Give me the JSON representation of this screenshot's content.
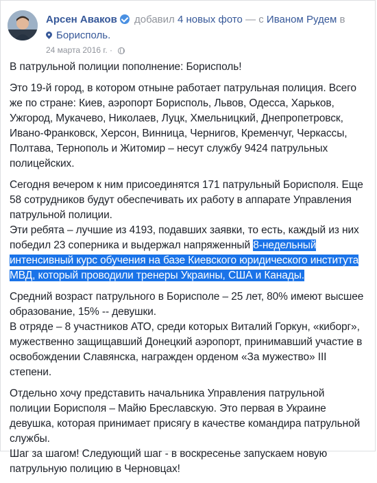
{
  "post": {
    "author": "Арсен Аваков",
    "action_prefix": "добавил",
    "action_link": "4 новых фото",
    "with_label": "— с",
    "with_person": "Иваном Рудем",
    "in_label": "в",
    "location": "Борисполь.",
    "timestamp": "24 марта 2016 г.",
    "audience_separator": "·",
    "colors": {
      "link": "#365899",
      "muted": "#90949c",
      "selection": "#1a73e8"
    }
  },
  "content": {
    "p1": [
      "В патрульной полиции пополнение: Борисполь!"
    ],
    "p2": [
      "Это 19-й город, в котором отныне работает патрульная полиция. Всего",
      "же по стране: Киев, аэропорт Борисполь, Львов, Одесса, Харьков,",
      "Ужгород, Мукачево, Николаев, Луцк, Хмельницкий, Днепропетровск,",
      "Ивано-Франковск, Херсон, Винница, Чернигов, Кременчуг, Черкассы,",
      "Полтава, Тернополь и Житомир – несут службу 9424 патрульных",
      "полицейских."
    ],
    "p3": [
      "Сегодня вечером к ним присоединятся 171 патрульный Борисполя. Еще",
      "58 сотрудников будут обеспечивать их работу в аппарате Управления",
      "патрульной полиции.",
      "Эти ребята – лучшие из 4193, подавших заявки, то есть, каждый из них"
    ],
    "p3_line5_plain": "победил 23 соперника и выдержал напряженный ",
    "p3_line5_highlight": "8-недельный",
    "p3_highlight_lines": [
      "интенсивный курс обучения на базе Киевского юридического института",
      "МВД, который проводили тренеры Украины, США и Канады."
    ],
    "p4": [
      "Средний возраст патрульного в Борисполе – 25 лет, 80% имеют высшее",
      "образование, 15% -- девушки.",
      "В отряде – 8 участников АТО, среди которых Виталий Горкун, «киборг»,",
      "мужественно защищавший Донецкий аэропорт, принимавший участие в",
      "освобождении Славянска, награжден орденом «За мужество» III",
      "степени."
    ],
    "p5": [
      "Отдельно хочу представить начальника Управления патрульной",
      "полиции Борисполя – Майю Бреславскую. Это первая в Украине",
      "девушка, которая принимает присягу в качестве командира патрульной",
      "службы.",
      "Шаг за шагом! Следующий шаг - в воскресенье запускаем новую",
      "патрульную полицию в Черновцах!"
    ]
  }
}
